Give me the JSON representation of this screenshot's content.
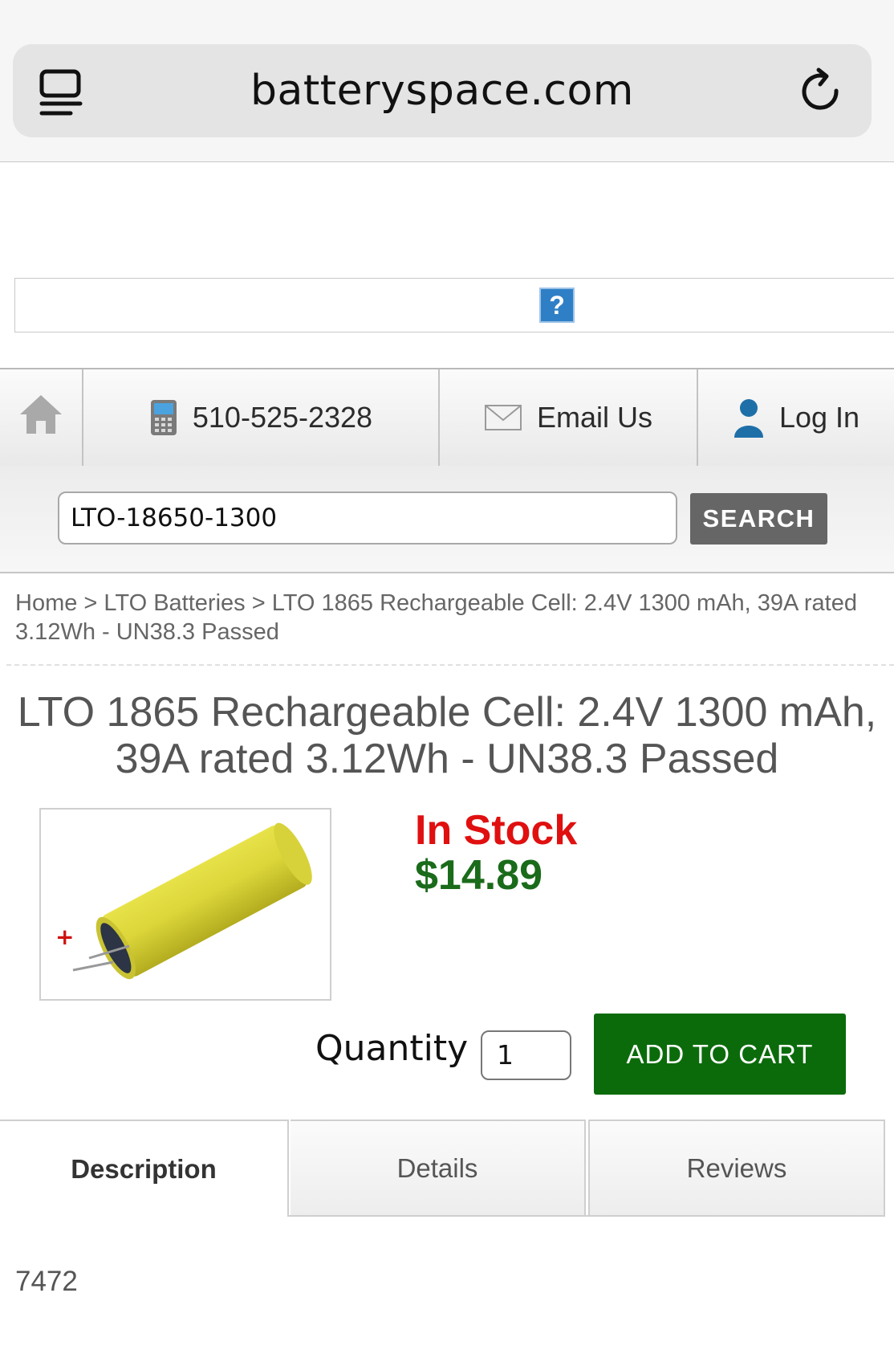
{
  "browser": {
    "url": "batteryspace.com"
  },
  "banner": {
    "broken_image_glyph": "?"
  },
  "nav": {
    "home_icon": "home-icon",
    "phone": "510-525-2328",
    "email": "Email Us",
    "login": "Log In"
  },
  "search": {
    "value": "LTO-18650-1300",
    "button": "SEARCH"
  },
  "breadcrumb": {
    "home": "Home",
    "sep": ">",
    "category": "LTO Batteries",
    "current": "LTO 1865 Rechargeable Cell: 2.4V 1300 mAh, 39A rated 3.12Wh - UN38.3 Passed"
  },
  "product": {
    "title_line1": "LTO 1865 Rechargeable Cell: 2.4V 1300 mAh,",
    "title_line2": "39A rated 3.12Wh - UN38.3 Passed",
    "stock": "In Stock",
    "price": "$14.89",
    "plus_mark": "+",
    "quantity_label": "Quantity",
    "quantity_value": "1",
    "add_to_cart": "ADD TO CART"
  },
  "tabs": [
    "Description",
    "Details",
    "Reviews"
  ],
  "description_text": "7472",
  "colors": {
    "stock": "#e01010",
    "price": "#1a6b1a",
    "cart_button": "#0b6b0b",
    "search_button": "#666666"
  }
}
